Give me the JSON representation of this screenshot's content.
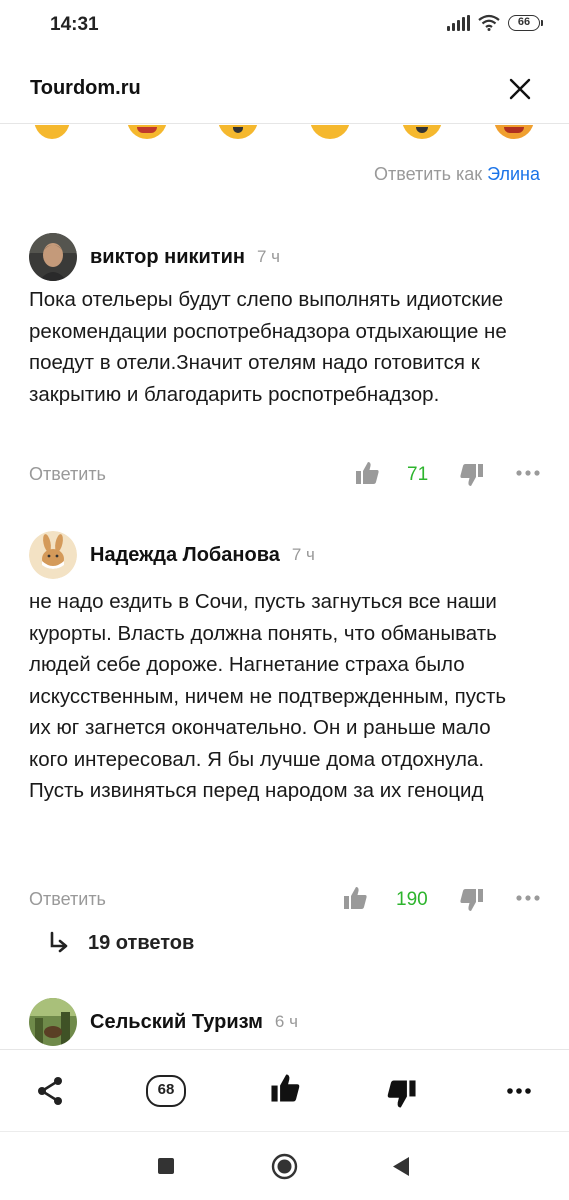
{
  "status": {
    "time": "14:31",
    "battery": "66"
  },
  "header": {
    "title": "Tourdom.ru"
  },
  "reply_as": {
    "prefix": "Ответить как",
    "name": "Элина"
  },
  "comments": [
    {
      "author": "виктор никитин",
      "time": "7 ч",
      "text": "Пока отельеры будут слепо выполнять идиотские рекомендации роспотребнадзора отдыхающие не поедут в отели.Значит отелям надо готовится к закрытию и благодарить роспотребнадзор.",
      "reply_label": "Ответить",
      "likes": "71"
    },
    {
      "author": "Надежда Лобанова",
      "time": "7 ч",
      "text": "не надо ездить в Сочи, пусть загнуться все наши курорты. Власть должна понять, что обманывать людей себе дороже. Нагнетание страха было искусственным, ничем не подтвержденным, пусть их юг загнется окончательно. Он и раньше мало кого интересовал. Я бы лучше дома отдохнула. Пусть извиняться перед народом за их геноцид",
      "reply_label": "Ответить",
      "likes": "190",
      "replies_label": "19 ответов"
    },
    {
      "author": "Сельский Туризм",
      "time": "6 ч"
    }
  ],
  "bottom_bar": {
    "comments_count": "68"
  },
  "colors": {
    "like_green": "#2db42d",
    "link_blue": "#1a73e8",
    "muted": "#999999"
  },
  "icons": [
    "share-icon",
    "comments-icon",
    "thumbs-up-icon",
    "thumbs-down-icon",
    "more-icon",
    "close-icon"
  ]
}
